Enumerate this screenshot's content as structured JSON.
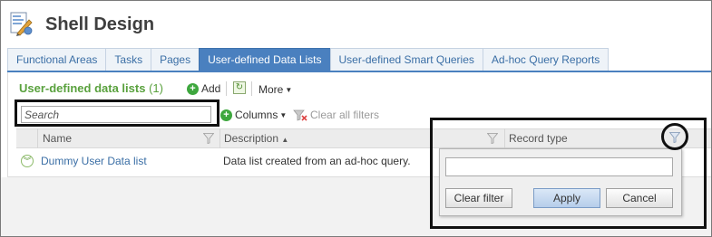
{
  "header": {
    "title": "Shell Design",
    "icon": "shell-design-icon"
  },
  "tabs": [
    {
      "label": "Functional Areas",
      "active": false
    },
    {
      "label": "Tasks",
      "active": false
    },
    {
      "label": "Pages",
      "active": false
    },
    {
      "label": "User-defined Data Lists",
      "active": true
    },
    {
      "label": "User-defined Smart Queries",
      "active": false
    },
    {
      "label": "Ad-hoc Query Reports",
      "active": false
    }
  ],
  "section": {
    "title": "User-defined data lists",
    "count": "(1)"
  },
  "toolbar": {
    "add_label": "Add",
    "more_label": "More"
  },
  "search": {
    "placeholder": "Search",
    "value": ""
  },
  "grid_toolbar": {
    "columns_label": "Columns",
    "clear_filters_label": "Clear all filters"
  },
  "columns": {
    "name": "Name",
    "description": "Description",
    "record_type": "Record type",
    "description_sort": "▲"
  },
  "rows": [
    {
      "name": "Dummy User Data list",
      "description": "Data list created from an ad-hoc query.",
      "record_type": ""
    }
  ],
  "filter_popup": {
    "value": "",
    "clear_label": "Clear filter",
    "apply_label": "Apply",
    "cancel_label": "Cancel"
  },
  "colors": {
    "accent": "#4a80bf",
    "section_title": "#59a13d",
    "link": "#3a6ea5"
  }
}
